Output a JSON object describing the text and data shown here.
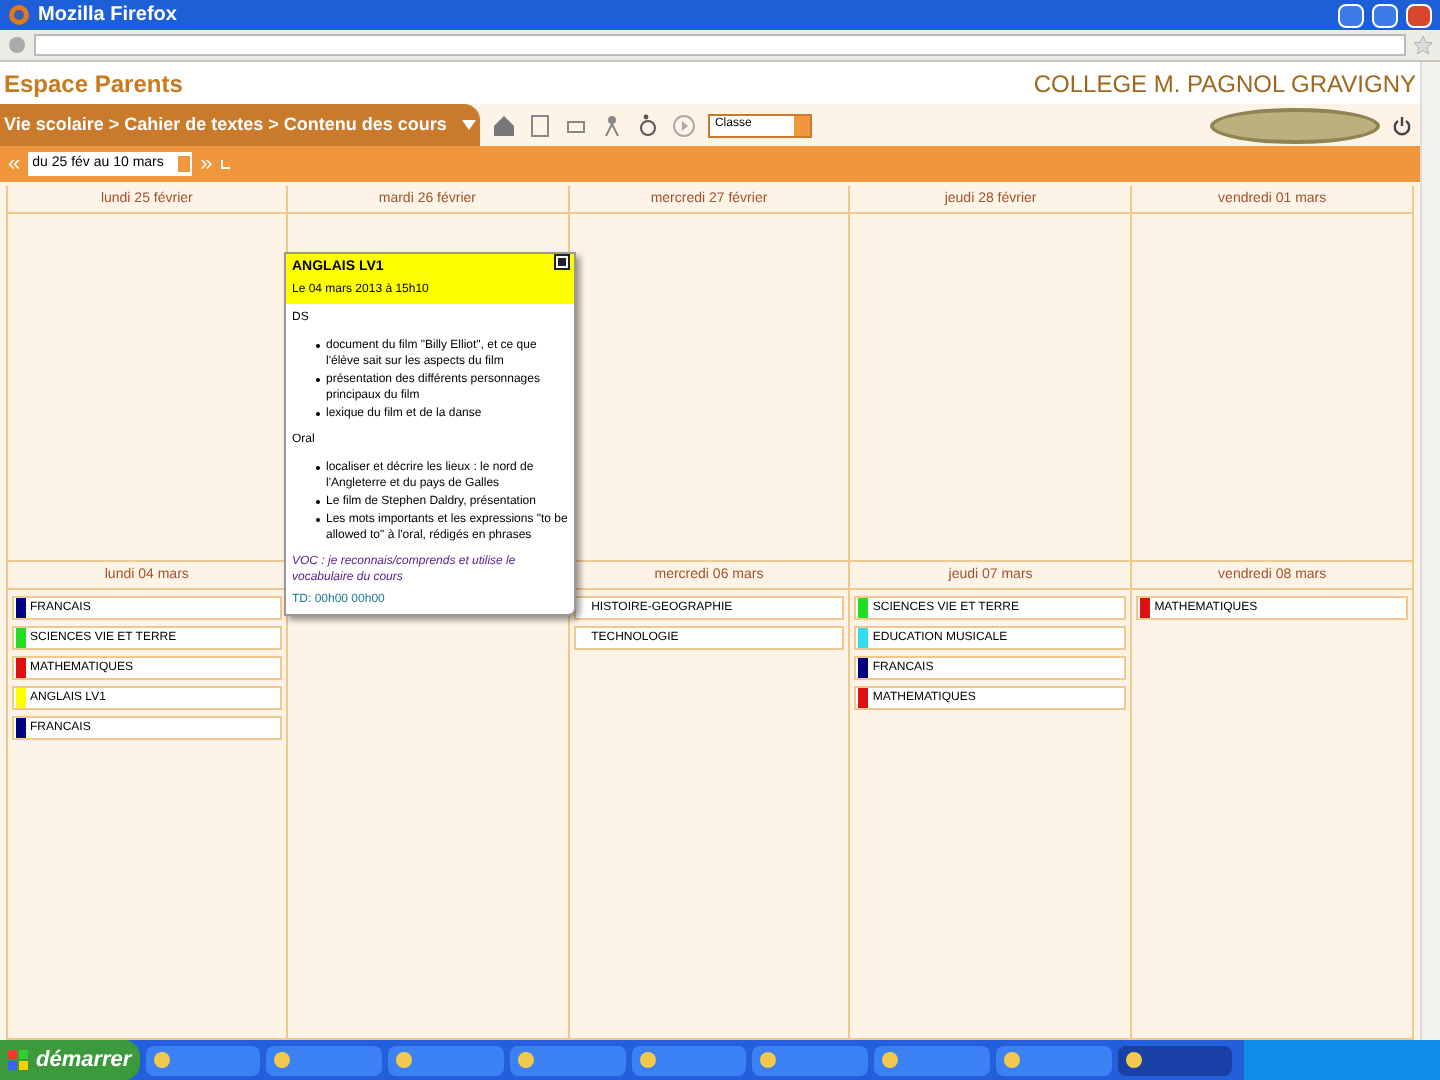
{
  "window": {
    "title": "Mozilla Firefox"
  },
  "header": {
    "title": "Espace Parents",
    "school": "COLLEGE M. PAGNOL GRAVIGNY"
  },
  "breadcrumb": "Vie scolaire > Cahier de textes > Contenu des cours",
  "toolbar": {
    "select_value": "Classe"
  },
  "date_bar": {
    "prev": "«",
    "range": "du 25 fév au 10 mars",
    "next": "»"
  },
  "weeks": [
    {
      "days": [
        {
          "label": "lundi 25 février"
        },
        {
          "label": "mardi 26 février"
        },
        {
          "label": "mercredi 27 février"
        },
        {
          "label": "jeudi 28 février"
        },
        {
          "label": "vendredi 01 mars"
        }
      ]
    },
    {
      "days": [
        {
          "label": "lundi 04 mars",
          "entries": [
            {
              "name": "FRANCAIS",
              "color": "#000080"
            },
            {
              "name": "SCIENCES VIE ET TERRE",
              "color": "#22dd22"
            },
            {
              "name": "MATHEMATIQUES",
              "color": "#dd1111"
            },
            {
              "name": "ANGLAIS LV1",
              "color": "#ffff00"
            },
            {
              "name": "FRANCAIS",
              "color": "#000080"
            }
          ]
        },
        {
          "covered": true
        },
        {
          "label": "mercredi 06 mars",
          "entries": [
            {
              "name": "HISTOIRE-GEOGRAPHIE"
            },
            {
              "name": "TECHNOLOGIE"
            }
          ]
        },
        {
          "label": "jeudi 07 mars",
          "entries": [
            {
              "name": "SCIENCES VIE ET TERRE",
              "color": "#22dd22"
            },
            {
              "name": "EDUCATION MUSICALE",
              "color": "#33ddee"
            },
            {
              "name": "FRANCAIS",
              "color": "#000080"
            },
            {
              "name": "MATHEMATIQUES",
              "color": "#dd1111"
            }
          ]
        },
        {
          "label": "vendredi 08 mars",
          "entries": [
            {
              "name": "MATHEMATIQUES",
              "color": "#dd1111"
            }
          ]
        }
      ]
    }
  ],
  "taskbar_start": "démarrer",
  "popup": {
    "title": "ANGLAIS LV1",
    "date": "Le 04 mars 2013 à 15h10",
    "sections": [
      {
        "heading": "DS",
        "bullets": [
          "document du film \"Billy Elliot\", et ce que l'élève sait sur les aspects du film",
          "présentation des différents personnages principaux du film",
          "lexique du film et de la danse"
        ]
      },
      {
        "heading": "Oral",
        "bullets": [
          "localiser et décrire les lieux : le nord de l'Angleterre et du pays de Galles",
          "Le film de Stephen Daldry, présentation",
          "Les mots importants et les expressions \"to be allowed to\" à l'oral, rédigés en phrases"
        ]
      }
    ],
    "footer_text": "VOC : je reconnais/comprends et utilise le vocabulaire du cours",
    "link": "TD: 00h00 00h00"
  }
}
